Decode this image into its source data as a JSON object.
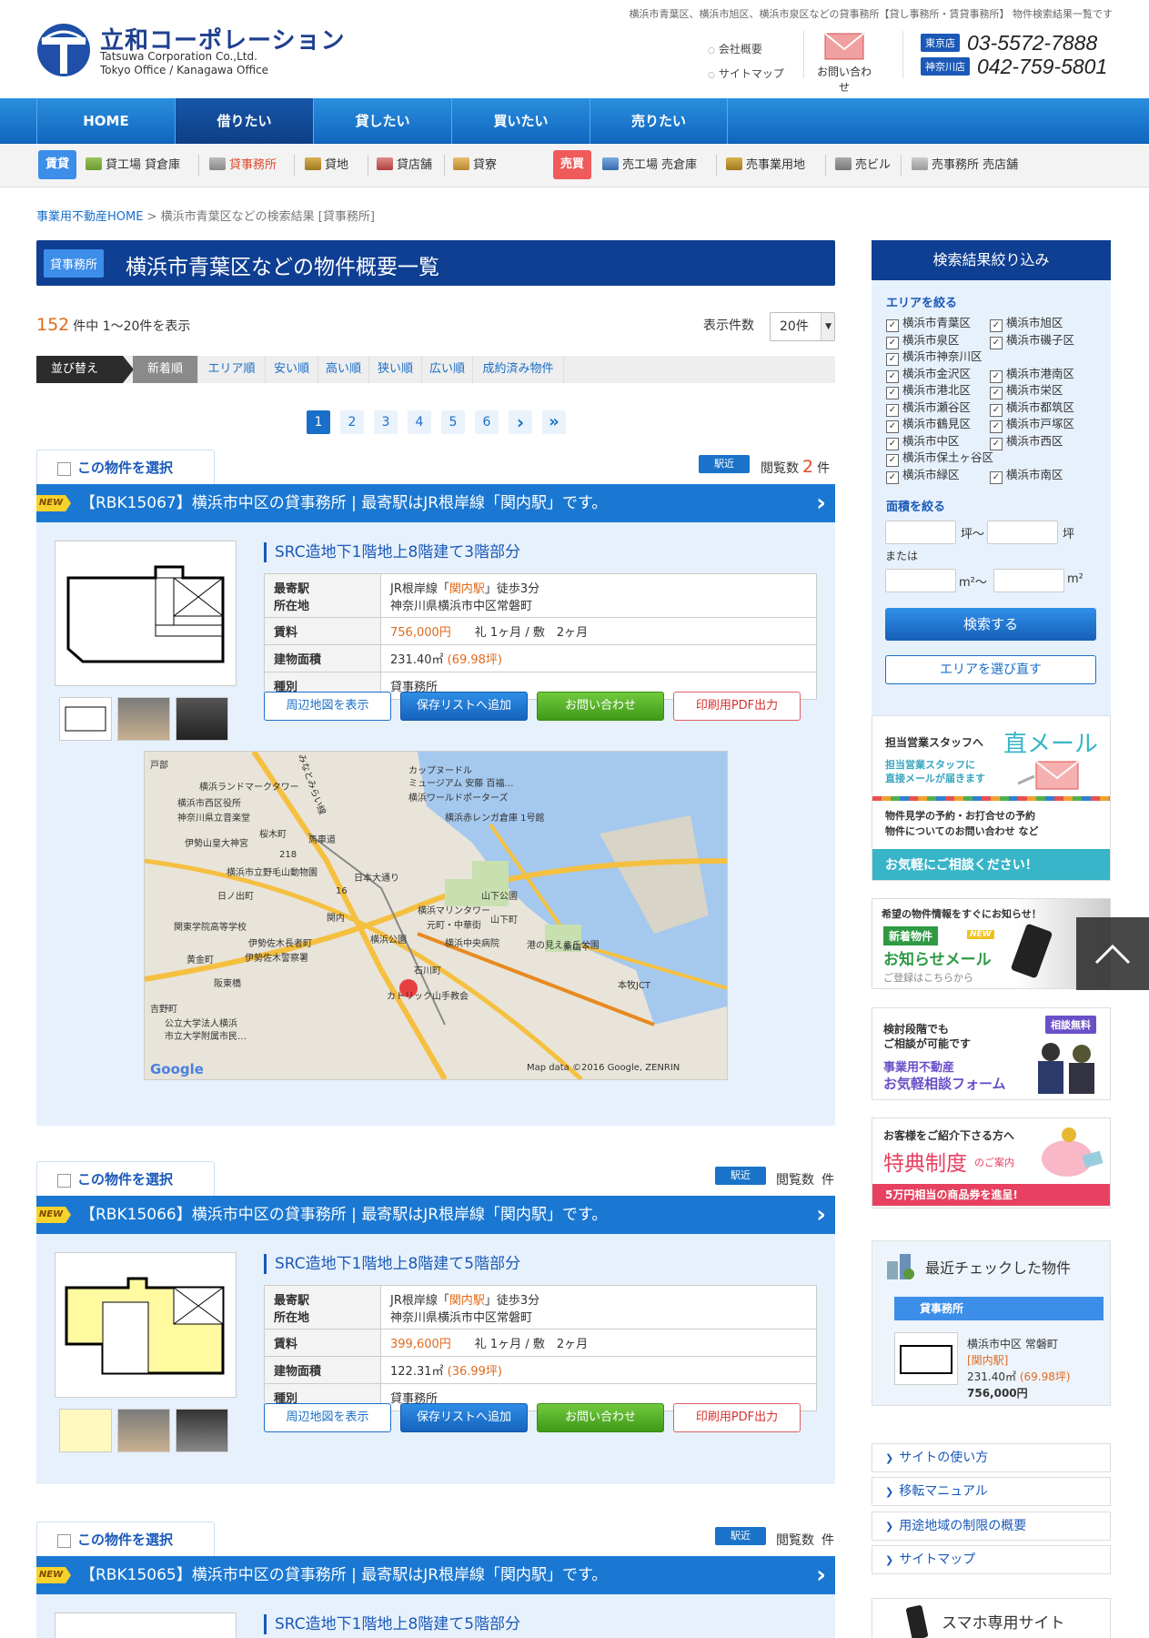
{
  "header": {
    "logo_ja": "立和コーポレーション",
    "logo_en_1": "Tatsuwa Corporation Co.,Ltd.",
    "logo_en_2": "Tokyo Office / Kanagawa Office",
    "tagline": "横浜市青葉区、横浜市旭区、横浜市泉区などの貸事務所【貸し事務所・賃貸事務所】 物件検索結果一覧です",
    "link_company": "会社概要",
    "link_sitemap": "サイトマップ",
    "contact_label": "お問い合わせ",
    "tokyo_tag": "東京店",
    "tokyo_phone": "03-5572-7888",
    "kanagawa_tag": "神奈川店",
    "kanagawa_phone": "042-759-5801"
  },
  "nav": [
    "HOME",
    "借りたい",
    "貸したい",
    "買いたい",
    "売りたい"
  ],
  "subnav": {
    "rent_tag": "賃貸",
    "rent_items": [
      "貸工場 貸倉庫",
      "貸事務所",
      "貸地",
      "貸店舗",
      "貸寮"
    ],
    "sale_tag": "売買",
    "sale_items": [
      "売工場 売倉庫",
      "売事業用地",
      "売ビル",
      "売事務所 売店舗"
    ]
  },
  "breadcrumb": {
    "home": "事業用不動産HOME",
    "sep": ">",
    "current": "横浜市青葉区などの検索結果 [貸事務所]"
  },
  "title": {
    "tag": "貸事務所",
    "text": "横浜市青葉区などの物件概要一覧"
  },
  "result": {
    "count": "152",
    "suffix": "件中 1～20件を表示",
    "perpage_label": "表示件数",
    "perpage_value": "20件"
  },
  "sort": {
    "label": "並び替え",
    "options": [
      "新着順",
      "エリア順",
      "安い順",
      "高い順",
      "狭い順",
      "広い順",
      "成約済み物件"
    ]
  },
  "pagination": [
    "1",
    "2",
    "3",
    "4",
    "5",
    "6",
    "›",
    "»"
  ],
  "common": {
    "select_label": "この物件を選択",
    "near_label": "駅近",
    "views_label": "閲覧数",
    "views_unit": "件",
    "new_badge": "NEW",
    "k_station": "最寄駅",
    "k_address": "所在地",
    "k_rent": "賃料",
    "k_area": "建物面積",
    "k_type": "種別",
    "btn_map": "周辺地図を表示",
    "btn_save": "保存リストへ追加",
    "btn_contact": "お問い合わせ",
    "btn_pdf": "印刷用PDF出力"
  },
  "properties": [
    {
      "title": "【RBK15067】横浜市中区の貸事務所 | 最寄駅はJR根岸線「関内駅」です。",
      "views": "2",
      "subtitle": "SRC造地下1階地上8階建て3階部分",
      "station_pre": "JR根岸線「",
      "station": "関内駅",
      "station_post": "」徒歩3分",
      "address": "神奈川県横浜市中区常磐町",
      "rent": "756,000円",
      "deposit": "礼 1ヶ月 / 敷　2ヶ月",
      "area": "231.40㎡",
      "tsubo": "(69.98坪)",
      "type": "貸事務所"
    },
    {
      "title": "【RBK15066】横浜市中区の貸事務所 | 最寄駅はJR根岸線「関内駅」です。",
      "views": "",
      "subtitle": "SRC造地下1階地上8階建て5階部分",
      "station_pre": "JR根岸線「",
      "station": "関内駅",
      "station_post": "」徒歩3分",
      "address": "神奈川県横浜市中区常磐町",
      "rent": "399,600円",
      "deposit": "礼 1ヶ月 / 敷　2ヶ月",
      "area": "122.31㎡",
      "tsubo": "(36.99坪)",
      "type": "貸事務所"
    },
    {
      "title": "【RBK15065】横浜市中区の貸事務所 | 最寄駅はJR根岸線「関内駅」です。",
      "views": "",
      "subtitle": "SRC造地下1階地上8階建て5階部分"
    }
  ],
  "map": {
    "labels": [
      "戸部",
      "横浜ランドマークタワー",
      "横浜市西区役所",
      "神奈川県立音楽堂",
      "伊勢山皇大神宮",
      "桜木町",
      "馬車道",
      "カップヌードル",
      "ミュージアム 安藤 百福…",
      "横浜ワールドポーターズ",
      "横浜赤レンガ倉庫 1号館",
      "横浜市立野毛山動物園",
      "日ノ出町",
      "日本大通り",
      "山下公園",
      "関東学院高等学校",
      "関内",
      "横浜マリンタワー",
      "元町・中華街",
      "山下町",
      "伊勢佐木長者町",
      "伊勢佐木警察署",
      "横浜公園",
      "横浜中央病院",
      "港の見える丘公園",
      "新山下",
      "黄金町",
      "石川町",
      "阪東橋",
      "カトリック山手教会",
      "吉野町",
      "公立大学法人横浜",
      "市立大学附属市民…",
      "本牧JCT",
      "Google",
      "Map data ©2016 Google, ZENRIN",
      "みなとみらい線",
      "218",
      "16"
    ]
  },
  "sidebar": {
    "title": "検索結果絞り込み",
    "area_label": "エリアを絞る",
    "areas": [
      "横浜市青葉区",
      "横浜市旭区",
      "横浜市泉区",
      "横浜市磯子区",
      "横浜市神奈川区",
      "横浜市金沢区",
      "横浜市港南区",
      "横浜市港北区",
      "横浜市栄区",
      "横浜市瀬谷区",
      "横浜市都筑区",
      "横浜市鶴見区",
      "横浜市戸塚区",
      "横浜市中区",
      "横浜市西区",
      "横浜市保土ヶ谷区",
      "横浜市緑区",
      "横浜市南区"
    ],
    "size_label": "面積を絞る",
    "unit_tsubo_from": "坪～",
    "unit_tsubo": "坪",
    "or": "または",
    "unit_m2_from": "m²～",
    "unit_m2": "m²",
    "search_btn": "検索する",
    "reselect_btn": "エリアを選び直す"
  },
  "banners": {
    "mail_1": "担当営業スタッフへ",
    "mail_2": "直メール",
    "mail_3": "担当営業スタッフに",
    "mail_4": "直接メールが届きます",
    "mail_5": "物件見学の予約・お打合せの予約",
    "mail_6": "物件についてのお問い合わせ など",
    "mail_7": "お気軽にご相談ください！",
    "news_1": "希望の物件情報をすぐにお知らせ！",
    "news_2": "新着物件",
    "news_new": "NEW",
    "news_3": "お知らせメール",
    "news_4": "ご登録はこちらから",
    "cons_1": "検討段階でも",
    "cons_2": "ご相談が可能です",
    "cons_tag": "相談無料",
    "cons_3": "事業用不動産",
    "cons_4": "お気軽相談フォーム",
    "perk_1": "お客様をご紹介下さる方へ",
    "perk_2": "特典制度",
    "perk_3": "のご案内",
    "perk_4": "5万円相当の商品券を進呈!",
    "recent_title": "最近チェックした物件",
    "recent_tag": "貸事務所",
    "recent_addr": "横浜市中区 常磐町",
    "recent_station": "[関内駅]",
    "recent_area": "231.40㎡",
    "recent_tsubo": "(69.98坪)",
    "recent_rent": "756,000円"
  },
  "side_links": [
    "サイトの使い方",
    "移転マニュアル",
    "用途地域の制限の概要",
    "サイトマップ"
  ],
  "smartphone": "スマホ専用サイト"
}
